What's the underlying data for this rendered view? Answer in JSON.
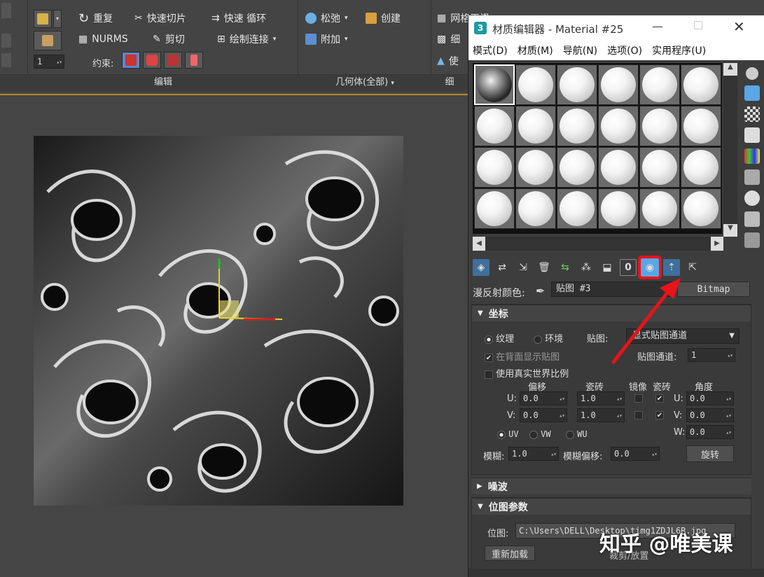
{
  "ribbon": {
    "edit": {
      "redo": "重复",
      "nurms": "NURMS",
      "constraint": "约束:",
      "quickslice": "快速切片",
      "cut": "剪切",
      "quickloop": "快速 循环",
      "drawconnect": "绘制连接",
      "footer": "编辑",
      "spinner_value": "1"
    },
    "geometry": {
      "relax": "松弛",
      "attach": "附加",
      "create": "创建",
      "footer": "几何体(全部)"
    },
    "right": {
      "r1": "网格平滑",
      "r2": "细",
      "r3": "使",
      "footer": "细"
    }
  },
  "material_editor": {
    "title": "材质编辑器 - Material #25",
    "menu": [
      "模式(D)",
      "材质(M)",
      "导航(N)",
      "选项(O)",
      "实用程序(U)"
    ],
    "diffuse_label": "漫反射颜色:",
    "map_name": "贴图 #3",
    "map_type": "Bitmap",
    "coords": {
      "header": "坐标",
      "texture": "纹理",
      "environ": "环境",
      "mapping_label": "贴图:",
      "mapping_value": "显式贴图通道",
      "show_back": "在背面显示贴图",
      "channel_label": "贴图通道:",
      "channel_value": "1",
      "real_world": "使用真实世界比例",
      "offset": "偏移",
      "tiling": "瓷砖",
      "mirror": "镜像",
      "tile": "瓷砖",
      "angle": "角度",
      "u_offset": "0.0",
      "v_offset": "0.0",
      "u_tiling": "1.0",
      "v_tiling": "1.0",
      "u_angle": "0.0",
      "v_angle": "0.0",
      "w_angle": "0.0",
      "uv": "UV",
      "vw": "VW",
      "wu": "WU",
      "blur_label": "模糊:",
      "blur_value": "1.0",
      "blur_offset_label": "模糊偏移:",
      "blur_offset_value": "0.0",
      "rotate": "旋转"
    },
    "noise_header": "噪波",
    "bitmap_params": {
      "header": "位图参数",
      "bitmap_label": "位图:",
      "bitmap_path": "C:\\Users\\DELL\\Desktop\\timg1ZDJL6R.jpg",
      "reload": "重新加载",
      "crop": "裁剪/放置"
    }
  },
  "watermark": "知乎 @唯美课",
  "colors": {
    "highlight": "#e8141a",
    "accent_blue": "#5aa6e6",
    "viewport_border": "#b58a2a"
  }
}
